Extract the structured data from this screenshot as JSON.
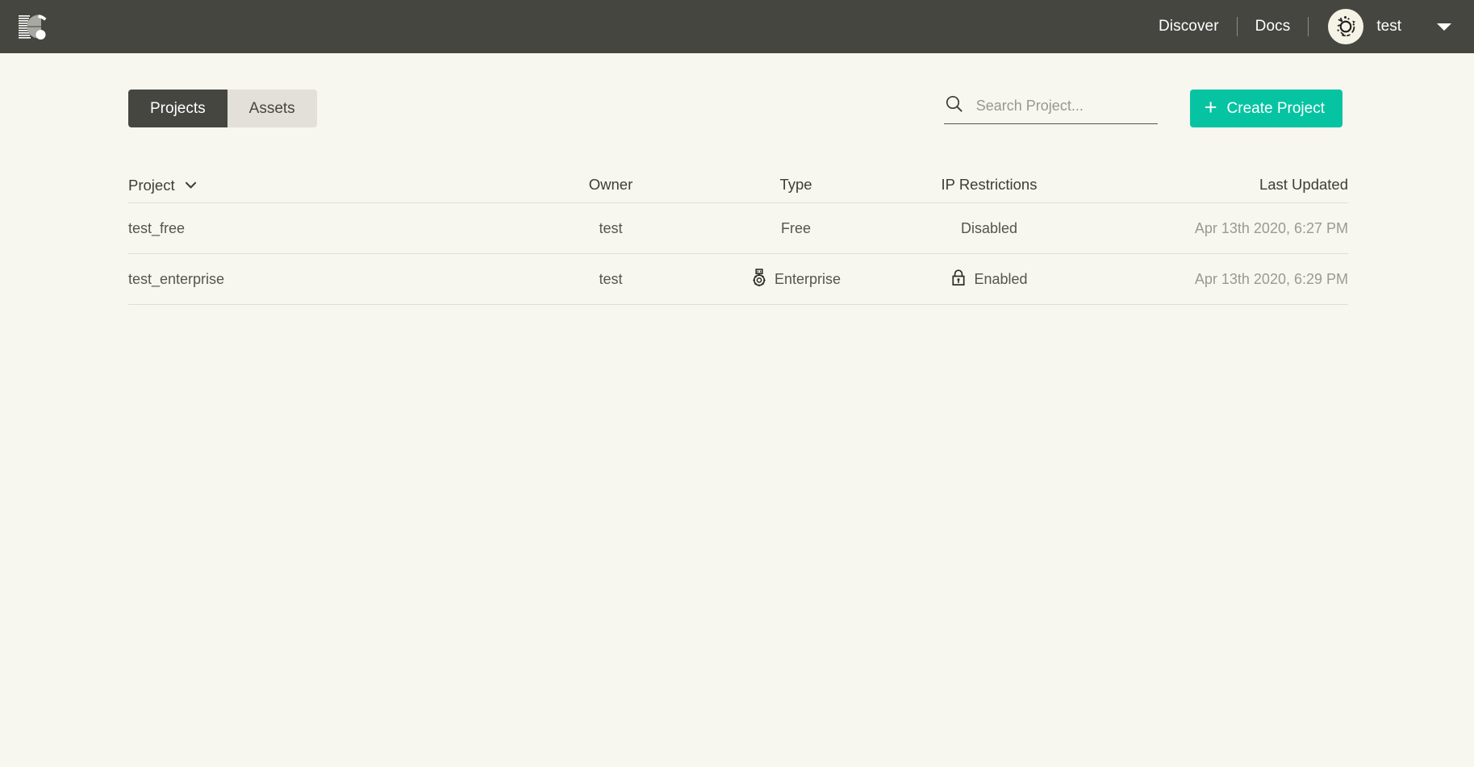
{
  "header": {
    "logo_icon": "eversion-e-logo",
    "nav": [
      {
        "label": "Discover",
        "name": "discover"
      },
      {
        "label": "Docs",
        "name": "docs"
      }
    ],
    "user": {
      "name": "test",
      "avatar_icon": "identicon-avatar",
      "caret_icon": "chevron-down-icon"
    },
    "colors": {
      "bar_bg": "#464641",
      "text": "#ffffff"
    }
  },
  "toolbar": {
    "tabs": [
      {
        "label": "Projects",
        "active": true
      },
      {
        "label": "Assets",
        "active": false
      }
    ],
    "search": {
      "placeholder": "Search Project...",
      "value": "",
      "icon": "search-icon"
    },
    "create_button": {
      "label": "Create Project",
      "icon": "plus-icon",
      "color": "#06c4a2"
    }
  },
  "table": {
    "columns": [
      {
        "key": "project",
        "label": "Project",
        "sortable": true,
        "sort_icon": "chevron-down-icon"
      },
      {
        "key": "owner",
        "label": "Owner"
      },
      {
        "key": "type",
        "label": "Type"
      },
      {
        "key": "ip",
        "label": "IP Restrictions"
      },
      {
        "key": "updated",
        "label": "Last Updated"
      }
    ],
    "rows": [
      {
        "project": "test_free",
        "owner": "test",
        "type": "Free",
        "type_icon": null,
        "ip": "Disabled",
        "ip_icon": null,
        "updated": "Apr 13th 2020, 6:27 PM"
      },
      {
        "project": "test_enterprise",
        "owner": "test",
        "type": "Enterprise",
        "type_icon": "medal-icon",
        "ip": "Enabled",
        "ip_icon": "lock-icon",
        "updated": "Apr 13th 2020, 6:29 PM"
      }
    ]
  },
  "page": {
    "background": "#f7f6ef",
    "row_divider": "#e0dfd6"
  }
}
